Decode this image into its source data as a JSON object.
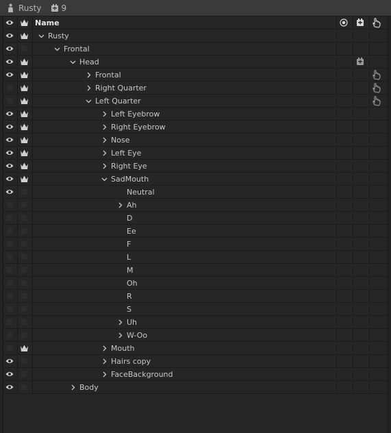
{
  "titlebar": {
    "title": "Rusty",
    "count": "9",
    "person_icon": "person-icon",
    "count_icon": "layers-icon"
  },
  "header": {
    "name_label": "Name",
    "icons": [
      "target-icon",
      "layers-icon",
      "hand-icon"
    ]
  },
  "rows": [
    {
      "label": "Rusty",
      "depth": 0,
      "expand": "open",
      "eye": true,
      "crown": true,
      "badge": ""
    },
    {
      "label": "Frontal",
      "depth": 1,
      "expand": "open",
      "eye": true,
      "crown": false,
      "badge": ""
    },
    {
      "label": "Head",
      "depth": 2,
      "expand": "open",
      "eye": true,
      "crown": true,
      "badge": "layers"
    },
    {
      "label": "Frontal",
      "depth": 3,
      "expand": "closed",
      "eye": true,
      "crown": true,
      "badge": "hand"
    },
    {
      "label": "Right Quarter",
      "depth": 3,
      "expand": "closed",
      "eye": false,
      "crown": true,
      "badge": "hand"
    },
    {
      "label": "Left Quarter",
      "depth": 3,
      "expand": "open",
      "eye": false,
      "crown": true,
      "badge": "hand"
    },
    {
      "label": "Left Eyebrow",
      "depth": 4,
      "expand": "closed",
      "eye": true,
      "crown": true,
      "badge": ""
    },
    {
      "label": "Right Eyebrow",
      "depth": 4,
      "expand": "closed",
      "eye": true,
      "crown": true,
      "badge": ""
    },
    {
      "label": "Nose",
      "depth": 4,
      "expand": "closed",
      "eye": true,
      "crown": true,
      "badge": ""
    },
    {
      "label": "Left Eye",
      "depth": 4,
      "expand": "closed",
      "eye": true,
      "crown": true,
      "badge": ""
    },
    {
      "label": "Right Eye",
      "depth": 4,
      "expand": "closed",
      "eye": true,
      "crown": true,
      "badge": ""
    },
    {
      "label": "SadMouth",
      "depth": 4,
      "expand": "open",
      "eye": true,
      "crown": true,
      "badge": ""
    },
    {
      "label": "Neutral",
      "depth": 5,
      "expand": "none",
      "eye": true,
      "crown": false,
      "badge": ""
    },
    {
      "label": "Ah",
      "depth": 5,
      "expand": "closed",
      "eye": false,
      "crown": false,
      "badge": ""
    },
    {
      "label": "D",
      "depth": 5,
      "expand": "none",
      "eye": false,
      "crown": false,
      "badge": ""
    },
    {
      "label": "Ee",
      "depth": 5,
      "expand": "none",
      "eye": false,
      "crown": false,
      "badge": ""
    },
    {
      "label": "F",
      "depth": 5,
      "expand": "none",
      "eye": false,
      "crown": false,
      "badge": ""
    },
    {
      "label": "L",
      "depth": 5,
      "expand": "none",
      "eye": false,
      "crown": false,
      "badge": ""
    },
    {
      "label": "M",
      "depth": 5,
      "expand": "none",
      "eye": false,
      "crown": false,
      "badge": ""
    },
    {
      "label": "Oh",
      "depth": 5,
      "expand": "none",
      "eye": false,
      "crown": false,
      "badge": ""
    },
    {
      "label": "R",
      "depth": 5,
      "expand": "none",
      "eye": false,
      "crown": false,
      "badge": ""
    },
    {
      "label": "S",
      "depth": 5,
      "expand": "none",
      "eye": false,
      "crown": false,
      "badge": ""
    },
    {
      "label": "Uh",
      "depth": 5,
      "expand": "closed",
      "eye": false,
      "crown": false,
      "badge": ""
    },
    {
      "label": "W-Oo",
      "depth": 5,
      "expand": "closed",
      "eye": false,
      "crown": false,
      "badge": ""
    },
    {
      "label": "Mouth",
      "depth": 4,
      "expand": "closed",
      "eye": false,
      "crown": true,
      "badge": ""
    },
    {
      "label": "Hairs copy",
      "depth": 4,
      "expand": "closed",
      "eye": true,
      "crown": false,
      "badge": ""
    },
    {
      "label": "FaceBackground",
      "depth": 4,
      "expand": "closed",
      "eye": true,
      "crown": false,
      "badge": ""
    },
    {
      "label": "Body",
      "depth": 2,
      "expand": "closed",
      "eye": true,
      "crown": false,
      "badge": ""
    }
  ]
}
